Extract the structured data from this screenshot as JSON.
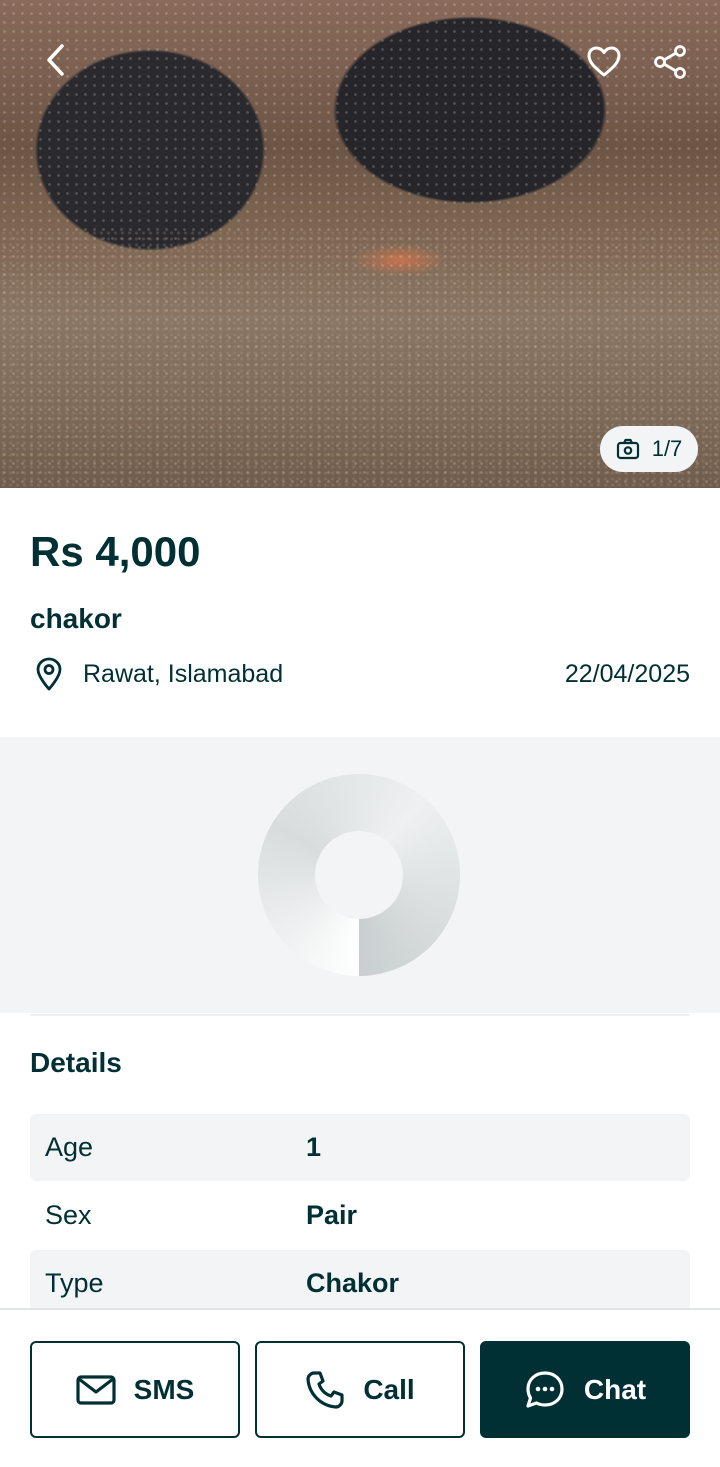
{
  "gallery": {
    "counter": "1/7"
  },
  "listing": {
    "price": "Rs 4,000",
    "title": "chakor",
    "location": "Rawat, Islamabad",
    "date": "22/04/2025"
  },
  "details": {
    "heading": "Details",
    "rows": [
      {
        "key": "Age",
        "value": "1"
      },
      {
        "key": "Sex",
        "value": "Pair"
      },
      {
        "key": "Type",
        "value": "Chakor"
      }
    ]
  },
  "actions": {
    "sms": "SMS",
    "call": "Call",
    "chat": "Chat"
  },
  "colors": {
    "primary": "#002f34",
    "surface": "#f2f4f5"
  },
  "icons": [
    "back-arrow-icon",
    "heart-icon",
    "share-icon",
    "camera-icon",
    "location-pin-icon",
    "mail-icon",
    "phone-icon",
    "chat-bubble-icon"
  ]
}
